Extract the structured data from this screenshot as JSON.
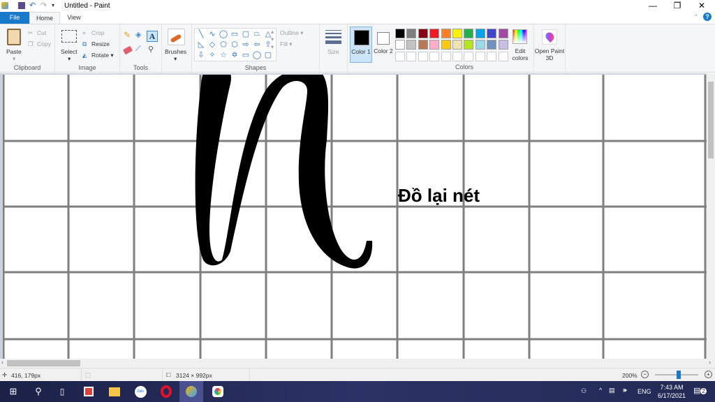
{
  "window": {
    "title": "Untitled - Paint",
    "minimize": "—",
    "restore": "❐",
    "close": "✕",
    "help": "?"
  },
  "tabs": [
    {
      "label": "File"
    },
    {
      "label": "Home"
    },
    {
      "label": "View"
    }
  ],
  "ribbon": {
    "clipboard": {
      "label": "Clipboard",
      "paste": "Paste",
      "cut": "Cut",
      "copy": "Copy"
    },
    "image": {
      "label": "Image",
      "select": "Select",
      "crop": "Crop",
      "resize": "Resize",
      "rotate": "Rotate ▾"
    },
    "tools": {
      "label": "Tools"
    },
    "brushes": {
      "label": "Brushes"
    },
    "shapes": {
      "label": "Shapes",
      "outline": "Outline ▾",
      "fill": "Fill ▾",
      "glyphs": [
        "╲",
        "∿",
        "◯",
        "▭",
        "▢",
        "⏢",
        "△",
        "◺",
        "◇",
        "⬠",
        "⬡",
        "⇨",
        "⇦",
        "⇧",
        "⇩",
        "✧",
        "☆",
        "✡",
        "▭",
        "◯",
        "▢"
      ]
    },
    "size": {
      "label": "Size"
    },
    "color1": {
      "label": "Color 1",
      "value": "#000000"
    },
    "color2": {
      "label": "Color 2",
      "value": "#ffffff"
    },
    "colors": {
      "label": "Colors",
      "palette": [
        "#000000",
        "#7f7f7f",
        "#880015",
        "#ed1c24",
        "#ff7f27",
        "#fff200",
        "#22b14c",
        "#00a2e8",
        "#3f48cc",
        "#a349a4",
        "#ffffff",
        "#c3c3c3",
        "#b97a57",
        "#ffaec9",
        "#ffc90e",
        "#efe4b0",
        "#b5e61d",
        "#99d9ea",
        "#7092be",
        "#c8bfe7"
      ]
    },
    "edit_colors": "Edit colors",
    "paint3d": "Open Paint 3D"
  },
  "canvas": {
    "text": "Đồ lại nét"
  },
  "status": {
    "cursor": "416, 179px",
    "size": "3124 × 992px",
    "zoom": "200%",
    "zoom_level_percent": 200
  },
  "taskbar": {
    "lang": "ENG",
    "time": "7:43 AM",
    "date": "6/17/2021",
    "notifications": "2"
  }
}
